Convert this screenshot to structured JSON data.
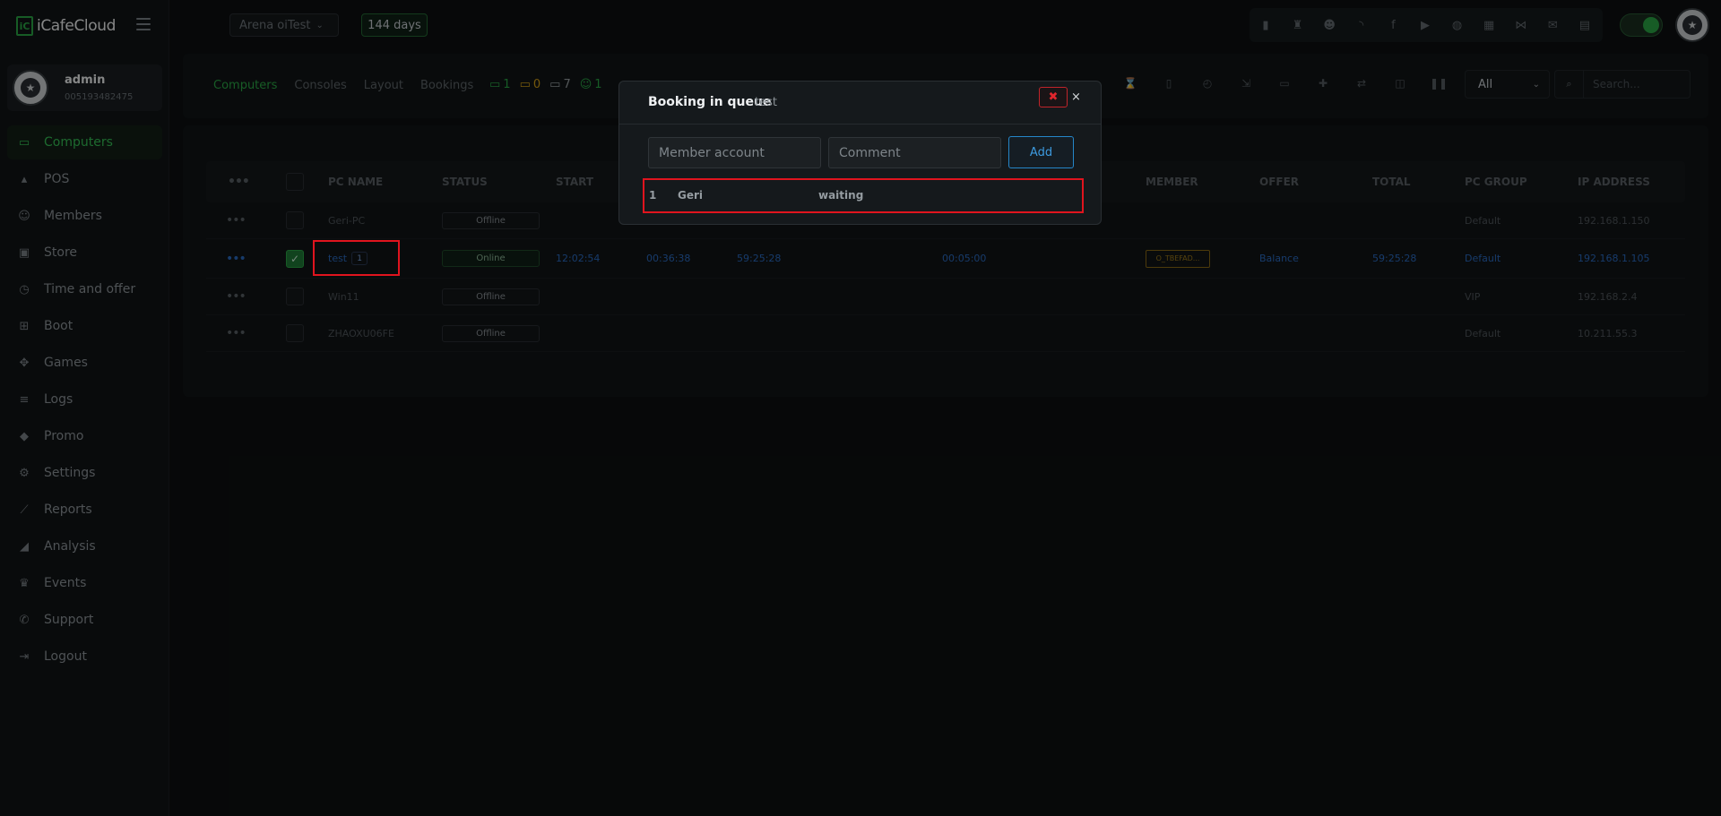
{
  "app": {
    "logo_mark": "iC",
    "logo_text": "iCafeCloud"
  },
  "profile": {
    "name": "admin",
    "id": "005193482475"
  },
  "nav": [
    {
      "label": "Computers",
      "icon": "monitor-icon",
      "glyph": "▭",
      "active": true
    },
    {
      "label": "POS",
      "icon": "cashier-icon",
      "glyph": "▴"
    },
    {
      "label": "Members",
      "icon": "members-icon",
      "glyph": "☺"
    },
    {
      "label": "Store",
      "icon": "bag-icon",
      "glyph": "▣"
    },
    {
      "label": "Time and offer",
      "icon": "clock-icon",
      "glyph": "◷"
    },
    {
      "label": "Boot",
      "icon": "windows-icon",
      "glyph": "⊞"
    },
    {
      "label": "Games",
      "icon": "gamepad-icon",
      "glyph": "✥"
    },
    {
      "label": "Logs",
      "icon": "list-icon",
      "glyph": "≡"
    },
    {
      "label": "Promo",
      "icon": "tag-icon",
      "glyph": "◆"
    },
    {
      "label": "Settings",
      "icon": "gear-icon",
      "glyph": "⚙"
    },
    {
      "label": "Reports",
      "icon": "line-chart-icon",
      "glyph": "⟋"
    },
    {
      "label": "Analysis",
      "icon": "area-chart-icon",
      "glyph": "◢"
    },
    {
      "label": "Events",
      "icon": "crown-icon",
      "glyph": "♛"
    },
    {
      "label": "Support",
      "icon": "phone-icon",
      "glyph": "✆"
    },
    {
      "label": "Logout",
      "icon": "logout-icon",
      "glyph": "⇥"
    }
  ],
  "header": {
    "store": "Arena oiTest",
    "days": "144 days",
    "icons": [
      {
        "name": "leaderboard-icon",
        "glyph": "▮"
      },
      {
        "name": "trophy-icon",
        "glyph": "♜"
      },
      {
        "name": "users-group-icon",
        "glyph": "☻"
      },
      {
        "name": "rss-icon",
        "glyph": "◝"
      },
      {
        "name": "facebook-icon",
        "glyph": "f"
      },
      {
        "name": "youtube-icon",
        "glyph": "▶"
      },
      {
        "name": "globe-icon",
        "glyph": "◍"
      },
      {
        "name": "icafe-icon",
        "glyph": "▦"
      },
      {
        "name": "handshake-icon",
        "glyph": "⋈"
      },
      {
        "name": "mail-icon",
        "glyph": "✉"
      },
      {
        "name": "chat-icon",
        "glyph": "▤"
      }
    ]
  },
  "tabs": [
    "Computers",
    "Consoles",
    "Layout",
    "Bookings"
  ],
  "counters": [
    {
      "name": "online-pc-counter",
      "value": "1",
      "color": "#2aa845"
    },
    {
      "name": "busy-pc-counter",
      "value": "0",
      "color": "#d4a017"
    },
    {
      "name": "offline-pc-counter",
      "value": "7",
      "color": "#9aa0a5"
    },
    {
      "name": "members-counter",
      "value": "1",
      "color": "#2aa845"
    }
  ],
  "toolbar_icons": [
    {
      "name": "hourglass-icon",
      "glyph": "⌛"
    },
    {
      "name": "door-icon",
      "glyph": "▯"
    },
    {
      "name": "alarm-icon",
      "glyph": "◴"
    },
    {
      "name": "exit-icon",
      "glyph": "⇲"
    },
    {
      "name": "ticket-icon",
      "glyph": "▭"
    },
    {
      "name": "user-add-icon",
      "glyph": "✚"
    },
    {
      "name": "user-transfer-icon",
      "glyph": "⇄"
    },
    {
      "name": "screenshot-icon",
      "glyph": "◫"
    },
    {
      "name": "pause-icon",
      "glyph": "❚❚"
    }
  ],
  "filter": {
    "value": "All"
  },
  "search": {
    "placeholder": "Search..."
  },
  "table": {
    "headers": [
      "PC NAME",
      "STATUS",
      "START",
      "MEMBER",
      "OFFER",
      "TOTAL",
      "PC GROUP",
      "IP ADDRESS"
    ],
    "rows": [
      {
        "name": "Geri-PC",
        "status": "Offline",
        "start": "",
        "used": "",
        "left": "",
        "remaining": "",
        "member": "",
        "offer": "",
        "total": "",
        "group": "Default",
        "ip": "192.168.1.150"
      },
      {
        "name": "test",
        "badge": "1",
        "status": "Online",
        "start": "12:02:54",
        "used": "00:36:38",
        "left": "59:25:28",
        "remaining": "00:05:00",
        "member": "O_TBEFAD...",
        "offer": "Balance",
        "total": "59:25:28",
        "group": "Default",
        "ip": "192.168.1.105"
      },
      {
        "name": "Win11",
        "status": "Offline",
        "start": "",
        "used": "",
        "left": "",
        "remaining": "",
        "member": "",
        "offer": "",
        "total": "",
        "group": "VIP",
        "ip": "192.168.2.4"
      },
      {
        "name": "ZHAOXU06FE",
        "status": "Offline",
        "start": "",
        "used": "",
        "left": "",
        "remaining": "",
        "member": "",
        "offer": "",
        "total": "",
        "group": "Default",
        "ip": "10.211.55.3"
      }
    ]
  },
  "modal": {
    "title": "Booking in queue",
    "subtitle": "test",
    "close": "×",
    "member_placeholder": "Member account",
    "comment_placeholder": "Comment",
    "add_label": "Add",
    "queue": [
      {
        "index": "1",
        "member": "Geri",
        "status": "waiting"
      }
    ],
    "delete_glyph": "✖"
  }
}
